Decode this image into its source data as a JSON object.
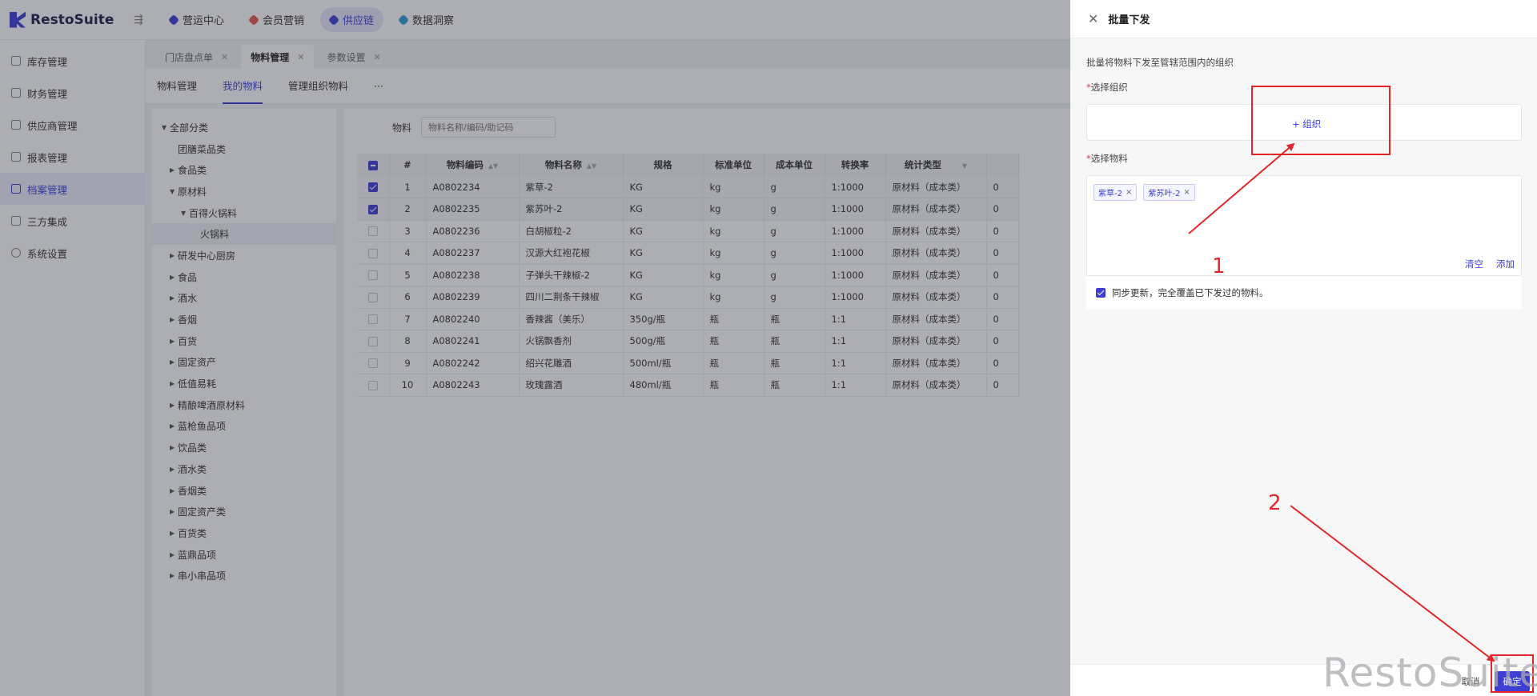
{
  "app": {
    "name": "RestoSuite"
  },
  "topnav": [
    {
      "label": "营运中心",
      "color": "#3d3fd4"
    },
    {
      "label": "会员营销",
      "color": "#e05d4a"
    },
    {
      "label": "供应链",
      "color": "#3d3fd4"
    },
    {
      "label": "数据洞察",
      "color": "#2f9ad8"
    }
  ],
  "sidebar": [
    {
      "label": "库存管理"
    },
    {
      "label": "财务管理"
    },
    {
      "label": "供应商管理"
    },
    {
      "label": "报表管理"
    },
    {
      "label": "档案管理"
    },
    {
      "label": "三方集成"
    },
    {
      "label": "系统设置"
    }
  ],
  "tabs": [
    {
      "label": "门店盘点单"
    },
    {
      "label": "物料管理"
    },
    {
      "label": "参数设置"
    }
  ],
  "subtabs": [
    {
      "label": "物料管理"
    },
    {
      "label": "我的物料"
    },
    {
      "label": "管理组织物料"
    },
    {
      "label": "···"
    }
  ],
  "tree": [
    "全部分类",
    "团膳菜品类",
    "食品类",
    "原材料",
    "百得火锅料",
    "火锅料",
    "研发中心厨房",
    "食品",
    "酒水",
    "香烟",
    "百货",
    "固定资产",
    "低值易耗",
    "精酿啤酒原材料",
    "蓝枪鱼品项",
    "饮品类",
    "酒水类",
    "香烟类",
    "固定资产类",
    "百货类",
    "蓝鼎品项",
    "串小串品项"
  ],
  "filter": {
    "label": "物料",
    "placeholder": "物料名称/编码/助记码"
  },
  "table": {
    "headers": [
      "#",
      "物料编码",
      "物料名称",
      "规格",
      "标准单位",
      "成本单位",
      "转换率",
      "统计类型"
    ],
    "rows": [
      [
        "1",
        "A0802234",
        "紫草-2",
        "KG",
        "kg",
        "g",
        "1:1000",
        "原材料（成本类）",
        "0"
      ],
      [
        "2",
        "A0802235",
        "紫苏叶-2",
        "KG",
        "kg",
        "g",
        "1:1000",
        "原材料（成本类）",
        "0"
      ],
      [
        "3",
        "A0802236",
        "白胡椒粒-2",
        "KG",
        "kg",
        "g",
        "1:1000",
        "原材料（成本类）",
        "0"
      ],
      [
        "4",
        "A0802237",
        "汉源大红袍花椒",
        "KG",
        "kg",
        "g",
        "1:1000",
        "原材料（成本类）",
        "0"
      ],
      [
        "5",
        "A0802238",
        "子弹头干辣椒-2",
        "KG",
        "kg",
        "g",
        "1:1000",
        "原材料（成本类）",
        "0"
      ],
      [
        "6",
        "A0802239",
        "四川二荆条干辣椒",
        "KG",
        "kg",
        "g",
        "1:1000",
        "原材料（成本类）",
        "0"
      ],
      [
        "7",
        "A0802240",
        "香辣酱（美乐）",
        "350g/瓶",
        "瓶",
        "瓶",
        "1:1",
        "原材料（成本类）",
        "0"
      ],
      [
        "8",
        "A0802241",
        "火锅飘香剂",
        "500g/瓶",
        "瓶",
        "瓶",
        "1:1",
        "原材料（成本类）",
        "0"
      ],
      [
        "9",
        "A0802242",
        "绍兴花雕酒",
        "500ml/瓶",
        "瓶",
        "瓶",
        "1:1",
        "原材料（成本类）",
        "0"
      ],
      [
        "10",
        "A0802243",
        "玫瑰露酒",
        "480ml/瓶",
        "瓶",
        "瓶",
        "1:1",
        "原材料（成本类）",
        "0"
      ]
    ]
  },
  "drawer": {
    "title": "批量下发",
    "description": "批量将物料下发至管辖范围内的组织",
    "org_label": "选择组织",
    "org_add": "+ 组织",
    "material_label": "选择物料",
    "tags": [
      "紫草-2",
      "紫苏叶-2"
    ],
    "clear": "清空",
    "add": "添加",
    "sync_text": "同步更新，完全覆盖已下发过的物料。",
    "cancel": "取消",
    "ok": "确定"
  },
  "annotations": {
    "step1": "1",
    "step2": "2"
  },
  "watermark": "RestoSuite"
}
